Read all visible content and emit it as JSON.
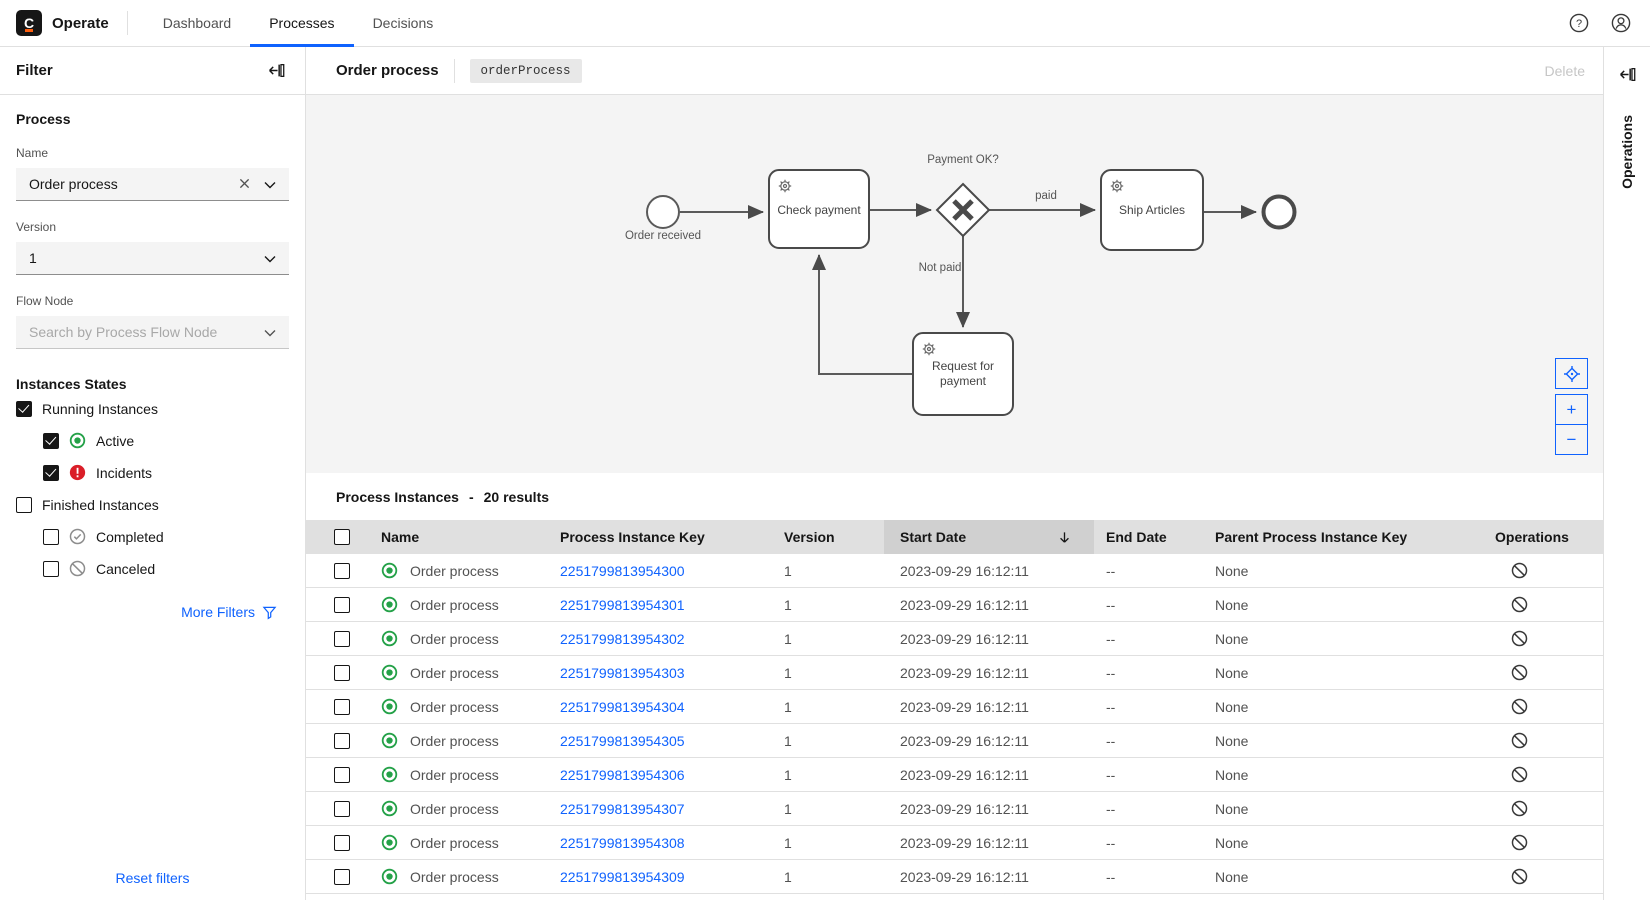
{
  "navbar": {
    "logo_letter": "C",
    "brand": "Operate",
    "tabs": [
      {
        "label": "Dashboard",
        "active": false
      },
      {
        "label": "Processes",
        "active": true
      },
      {
        "label": "Decisions",
        "active": false
      }
    ]
  },
  "filter_panel": {
    "title": "Filter",
    "process_section_title": "Process",
    "name_label": "Name",
    "name_value": "Order process",
    "version_label": "Version",
    "version_value": "1",
    "flow_node_label": "Flow Node",
    "flow_node_placeholder": "Search by Process Flow Node",
    "states_title": "Instances States",
    "states": [
      {
        "label": "Running Instances",
        "checked": true,
        "indent": 0,
        "icon": null
      },
      {
        "label": "Active",
        "checked": true,
        "indent": 1,
        "icon": "active"
      },
      {
        "label": "Incidents",
        "checked": true,
        "indent": 1,
        "icon": "incident"
      },
      {
        "label": "Finished Instances",
        "checked": false,
        "indent": 0,
        "icon": null
      },
      {
        "label": "Completed",
        "checked": false,
        "indent": 1,
        "icon": "completed"
      },
      {
        "label": "Canceled",
        "checked": false,
        "indent": 1,
        "icon": "canceled"
      }
    ],
    "more_filters_label": "More Filters",
    "reset_filters_label": "Reset filters"
  },
  "process_header": {
    "title": "Order process",
    "badge": "orderProcess",
    "delete_label": "Delete"
  },
  "diagram": {
    "start_event_label": "Order received",
    "task_check_payment": "Check payment",
    "gateway_label": "Payment OK?",
    "flow_paid_label": "paid",
    "flow_not_paid_label": "Not paid",
    "task_ship_articles": "Ship Articles",
    "task_request_line1": "Request for",
    "task_request_line2": "payment"
  },
  "instances": {
    "title": "Process Instances",
    "separator": "-",
    "results_count": "20 results",
    "columns": [
      "Name",
      "Process Instance Key",
      "Version",
      "Start Date",
      "End Date",
      "Parent Process Instance Key",
      "Operations"
    ],
    "sorted_column": "Start Date",
    "rows": [
      {
        "name": "Order process",
        "key": "2251799813954300",
        "version": "1",
        "start": "2023-09-29 16:12:11",
        "end": "--",
        "parent": "None"
      },
      {
        "name": "Order process",
        "key": "2251799813954301",
        "version": "1",
        "start": "2023-09-29 16:12:11",
        "end": "--",
        "parent": "None"
      },
      {
        "name": "Order process",
        "key": "2251799813954302",
        "version": "1",
        "start": "2023-09-29 16:12:11",
        "end": "--",
        "parent": "None"
      },
      {
        "name": "Order process",
        "key": "2251799813954303",
        "version": "1",
        "start": "2023-09-29 16:12:11",
        "end": "--",
        "parent": "None"
      },
      {
        "name": "Order process",
        "key": "2251799813954304",
        "version": "1",
        "start": "2023-09-29 16:12:11",
        "end": "--",
        "parent": "None"
      },
      {
        "name": "Order process",
        "key": "2251799813954305",
        "version": "1",
        "start": "2023-09-29 16:12:11",
        "end": "--",
        "parent": "None"
      },
      {
        "name": "Order process",
        "key": "2251799813954306",
        "version": "1",
        "start": "2023-09-29 16:12:11",
        "end": "--",
        "parent": "None"
      },
      {
        "name": "Order process",
        "key": "2251799813954307",
        "version": "1",
        "start": "2023-09-29 16:12:11",
        "end": "--",
        "parent": "None"
      },
      {
        "name": "Order process",
        "key": "2251799813954308",
        "version": "1",
        "start": "2023-09-29 16:12:11",
        "end": "--",
        "parent": "None"
      },
      {
        "name": "Order process",
        "key": "2251799813954309",
        "version": "1",
        "start": "2023-09-29 16:12:11",
        "end": "--",
        "parent": "None"
      }
    ]
  },
  "operations_panel": {
    "title": "Operations"
  },
  "colors": {
    "accent": "#0f62fe",
    "active_green": "#24a148",
    "incident_red": "#da1e28"
  }
}
